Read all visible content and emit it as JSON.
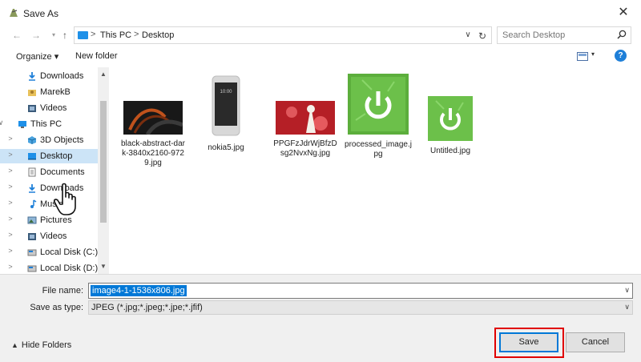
{
  "window": {
    "title": "Save As",
    "close": "✕"
  },
  "address": {
    "crumbs": [
      "This PC",
      "Desktop"
    ],
    "separator": ">",
    "search_placeholder": "Search Desktop"
  },
  "toolbar": {
    "organize": "Organize ▾",
    "new_folder": "New folder",
    "help": "?"
  },
  "tree": [
    {
      "label": "Downloads",
      "icon": "download-icon",
      "indent": 1,
      "twisty": ""
    },
    {
      "label": "MarekB",
      "icon": "user-folder-icon",
      "indent": 1,
      "twisty": ""
    },
    {
      "label": "Videos",
      "icon": "video-icon",
      "indent": 1,
      "twisty": ""
    },
    {
      "label": "This PC",
      "icon": "computer-icon",
      "indent": 0,
      "twisty": "∨"
    },
    {
      "label": "3D Objects",
      "icon": "cube-icon",
      "indent": 1,
      "twisty": ">"
    },
    {
      "label": "Desktop",
      "icon": "desktop-icon",
      "indent": 1,
      "twisty": ">",
      "selected": true
    },
    {
      "label": "Documents",
      "icon": "document-icon",
      "indent": 1,
      "twisty": ">"
    },
    {
      "label": "Downloads",
      "icon": "download-icon",
      "indent": 1,
      "twisty": ">"
    },
    {
      "label": "Music",
      "icon": "music-icon",
      "indent": 1,
      "twisty": ">"
    },
    {
      "label": "Pictures",
      "icon": "picture-icon",
      "indent": 1,
      "twisty": ">"
    },
    {
      "label": "Videos",
      "icon": "video-icon",
      "indent": 1,
      "twisty": ">"
    },
    {
      "label": "Local Disk (C:)",
      "icon": "drive-icon",
      "indent": 1,
      "twisty": ">"
    },
    {
      "label": "Local Disk (D:)",
      "icon": "drive-icon",
      "indent": 1,
      "twisty": ">"
    }
  ],
  "files": [
    {
      "name": "black-abstract-dark-3840x2160-9729.jpg",
      "thumb": "dark-abstract-thumbnail"
    },
    {
      "name": "nokia5.jpg",
      "thumb": "phone-thumbnail"
    },
    {
      "name": "PPGFzJdrWjBfzDsg2NvxNg.jpg",
      "thumb": "red-art-thumbnail"
    },
    {
      "name": "processed_image.jpg",
      "thumb": "power-green-thumbnail"
    },
    {
      "name": "Untitled.jpg",
      "thumb": "power-green-thumbnail"
    }
  ],
  "form": {
    "filename_label": "File name:",
    "filename_value": "image4-1-1536x806.jpg",
    "savetype_label": "Save as type:",
    "savetype_value": "JPEG (*.jpg;*.jpeg;*.jpe;*.jfif)"
  },
  "footer": {
    "hide_folders": "Hide Folders",
    "save": "Save",
    "cancel": "Cancel"
  },
  "colors": {
    "accent": "#0078d7",
    "highlight": "#e00000",
    "selected": "#cce4f7"
  }
}
